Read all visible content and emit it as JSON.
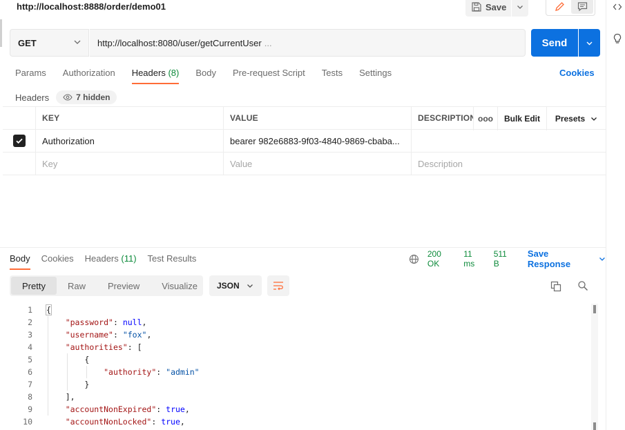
{
  "request": {
    "title": "http://localhost:8888/order/demo01",
    "save_label": "Save",
    "method": "GET",
    "url": "http://localhost:8080/user/getCurrentUser",
    "url_ellipsis": "...",
    "send_label": "Send"
  },
  "req_tabs": [
    {
      "label": "Params"
    },
    {
      "label": "Authorization"
    },
    {
      "label": "Headers",
      "count": "(8)"
    },
    {
      "label": "Body"
    },
    {
      "label": "Pre-request Script"
    },
    {
      "label": "Tests"
    },
    {
      "label": "Settings"
    }
  ],
  "cookies_label": "Cookies",
  "headers_panel": {
    "label": "Headers",
    "hidden_label": "7 hidden",
    "columns": {
      "key": "KEY",
      "value": "VALUE",
      "description": "DESCRIPTION"
    },
    "dots": "ooo",
    "bulk_edit": "Bulk Edit",
    "presets": "Presets",
    "rows": [
      {
        "key": "Authorization",
        "value": "bearer 982e6883-9f03-4840-9869-cbaba...",
        "description": ""
      }
    ],
    "placeholder": {
      "key": "Key",
      "value": "Value",
      "description": "Description"
    }
  },
  "response": {
    "tabs": [
      {
        "label": "Body"
      },
      {
        "label": "Cookies"
      },
      {
        "label": "Headers",
        "count": "(11)"
      },
      {
        "label": "Test Results"
      }
    ],
    "status": "200 OK",
    "time": "11 ms",
    "size": "511 B",
    "save_response": "Save Response",
    "view_modes": [
      "Pretty",
      "Raw",
      "Preview",
      "Visualize"
    ],
    "format": "JSON"
  },
  "code_lines": [
    {
      "n": "1",
      "t": "{"
    },
    {
      "n": "2",
      "t": "    \"password\": null,"
    },
    {
      "n": "3",
      "t": "    \"username\": \"fox\","
    },
    {
      "n": "4",
      "t": "    \"authorities\": ["
    },
    {
      "n": "5",
      "t": "        {"
    },
    {
      "n": "6",
      "t": "            \"authority\": \"admin\""
    },
    {
      "n": "7",
      "t": "        }"
    },
    {
      "n": "8",
      "t": "    ],"
    },
    {
      "n": "9",
      "t": "    \"accountNonExpired\": true,"
    },
    {
      "n": "10",
      "t": "    \"accountNonLocked\": true,"
    }
  ],
  "colors": {
    "accent": "#ff6c37",
    "send": "#0c71e0",
    "status_ok": "#0c8a3a",
    "json_key": "#a31515",
    "json_string": "#0451a5",
    "json_keyword": "#0000ff"
  },
  "icons": [
    "save-icon",
    "chevron-down-icon",
    "pencil-icon",
    "comment-icon",
    "code-icon",
    "bulb-icon",
    "eye-icon",
    "check-icon",
    "globe-icon",
    "wrap-icon",
    "copy-icon",
    "search-icon"
  ]
}
